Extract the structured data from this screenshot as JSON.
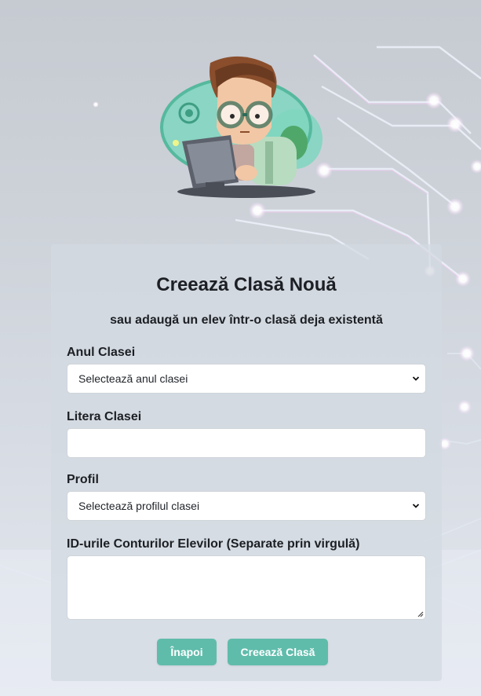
{
  "page": {
    "title": "Creează Clasă Nouă",
    "subtitle": "sau adaugă un elev într-o clasă deja existentă"
  },
  "form": {
    "year": {
      "label": "Anul Clasei",
      "selected": "Selectează anul clasei"
    },
    "letter": {
      "label": "Litera Clasei",
      "value": ""
    },
    "profile": {
      "label": "Profil",
      "selected": "Selectează profilul clasei"
    },
    "student_ids": {
      "label": "ID-urile Conturilor Elevilor (Separate prin virgulă)",
      "value": ""
    }
  },
  "buttons": {
    "back": "Înapoi",
    "create": "Creează Clasă"
  },
  "colors": {
    "accent": "#5fbcab",
    "text": "#1c1f24",
    "card": "#d2dae0"
  },
  "icons": {
    "dropdown": "chevron-down-icon",
    "textarea_resize": "resize-grip-icon",
    "mascot": "developer-mascot-illustration"
  }
}
